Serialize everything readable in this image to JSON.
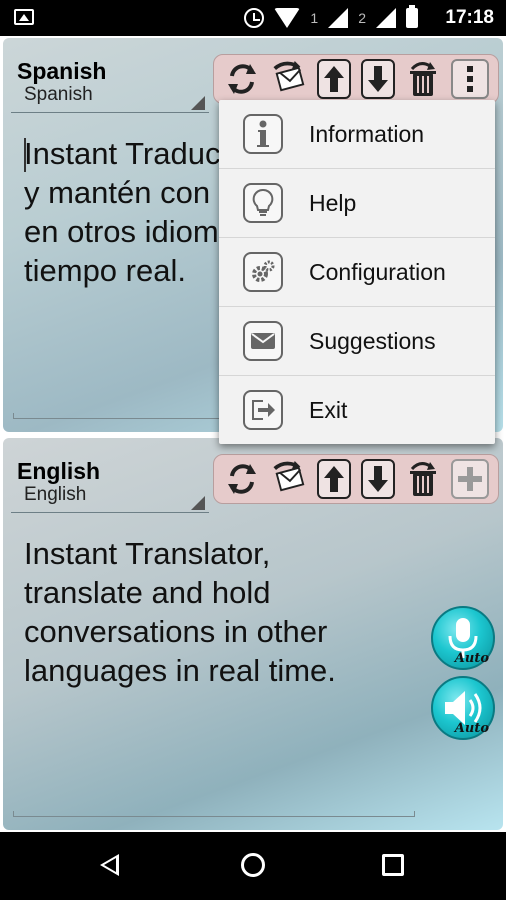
{
  "status_bar": {
    "time": "17:18",
    "sim1": "1",
    "sim2": "2"
  },
  "top_panel": {
    "language_title": "Spanish",
    "language_selected": "Spanish",
    "text": "Instant Traduc\ny  mantén con\nen otros idiom\ntiempo real."
  },
  "bottom_panel": {
    "language_title": "English",
    "language_selected": "English",
    "text": "Instant Translator,\ntranslate and hold\nconversations in other\nlanguages in real time.",
    "mic_label": "Auto",
    "speaker_label": "Auto"
  },
  "menu": {
    "items": [
      {
        "label": "Information",
        "icon": "info-icon"
      },
      {
        "label": "Help",
        "icon": "lightbulb-icon"
      },
      {
        "label": "Configuration",
        "icon": "gears-icon"
      },
      {
        "label": "Suggestions",
        "icon": "envelope-icon"
      },
      {
        "label": "Exit",
        "icon": "exit-icon"
      }
    ]
  },
  "colors": {
    "accent": "#1cc6cf",
    "toolbar_bg": "#e6cbcb"
  }
}
